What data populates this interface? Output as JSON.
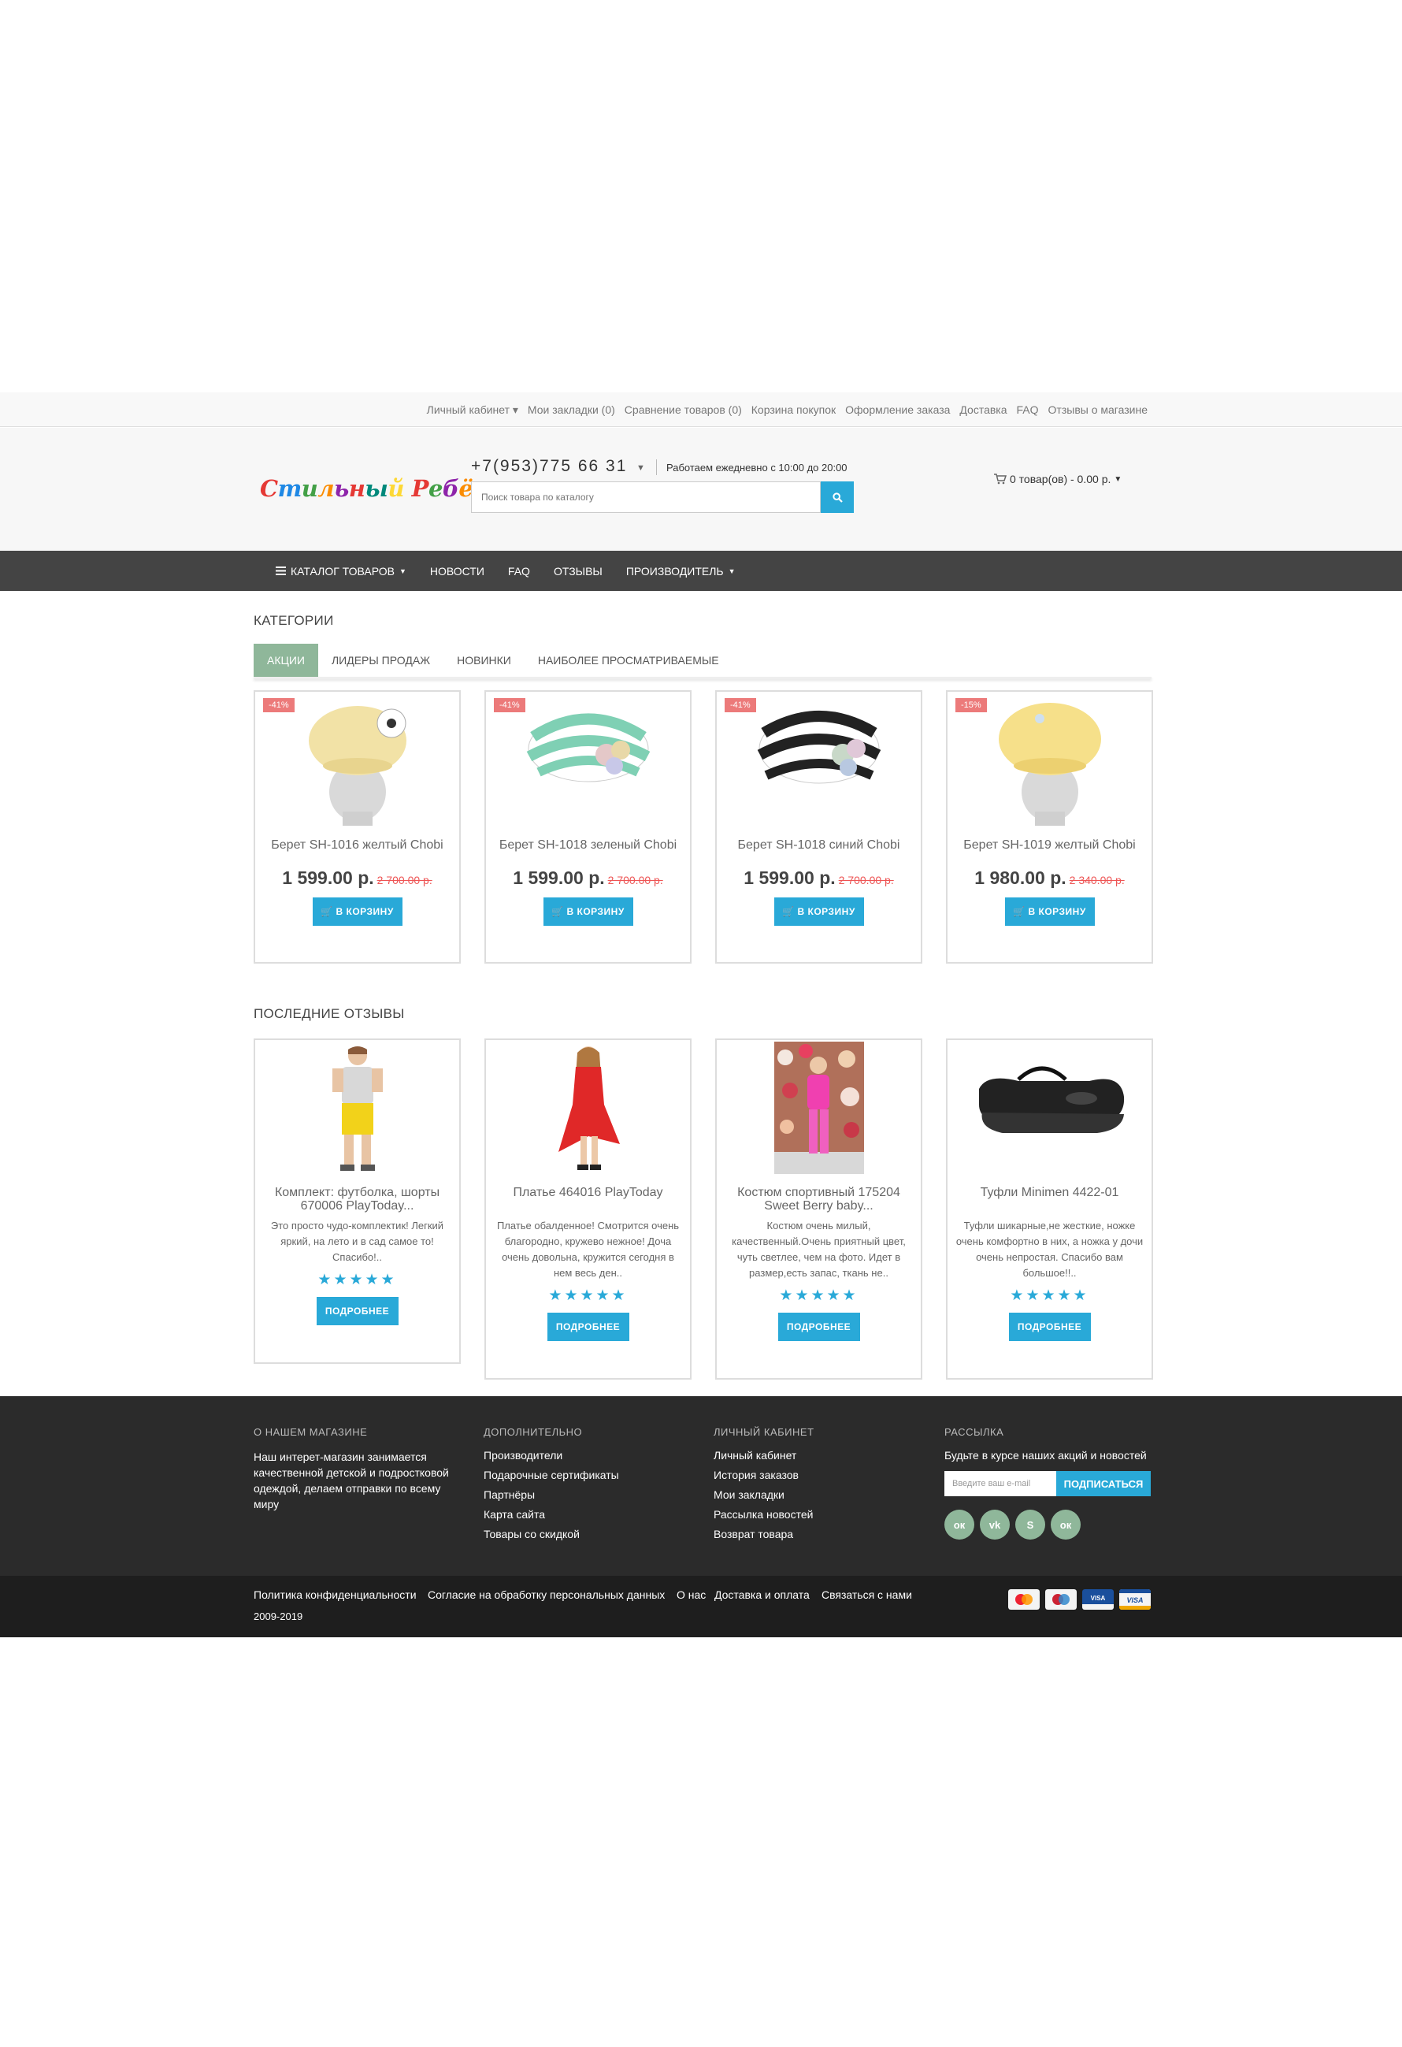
{
  "top_links": [
    {
      "label": "Личный кабинет",
      "caret": true
    },
    {
      "label": "Мои закладки (0)"
    },
    {
      "label": "Сравнение товаров (0)"
    },
    {
      "label": "Корзина покупок"
    },
    {
      "label": "Оформление заказа"
    },
    {
      "label": "Доставка"
    },
    {
      "label": "FAQ"
    },
    {
      "label": "Отзывы о магазине"
    }
  ],
  "header": {
    "logo_text": "Стильный Ребёнок",
    "phone": "+7(953)775 66 31",
    "hours": "Работаем ежедневно с 10:00 до 20:00",
    "search_placeholder": "Поиск товара по каталогу",
    "cart": "0 товар(ов) - 0.00 р."
  },
  "nav": [
    "КАТАЛОГ ТОВАРОВ",
    "НОВОСТИ",
    "FAQ",
    "ОТЗЫВЫ",
    "ПРОИЗВОДИТЕЛЬ"
  ],
  "categories": {
    "title": "КАТЕГОРИИ",
    "tabs": [
      "АКЦИИ",
      "ЛИДЕРЫ ПРОДАЖ",
      "НОВИНКИ",
      "НАИБОЛЕЕ ПРОСМАТРИВАЕМЫЕ"
    ],
    "products": [
      {
        "badge": "-41%",
        "name": "Берет SH-1016 желтый Chobi",
        "price": "1 599.00 р.",
        "old_price": "2 700.00 р.",
        "button": "В КОРЗИНУ"
      },
      {
        "badge": "-41%",
        "name": "Берет SH-1018 зеленый Chobi",
        "price": "1 599.00 р.",
        "old_price": "2 700.00 р.",
        "button": "В КОРЗИНУ"
      },
      {
        "badge": "-41%",
        "name": "Берет SH-1018 синий Chobi",
        "price": "1 599.00 р.",
        "old_price": "2 700.00 р.",
        "button": "В КОРЗИНУ"
      },
      {
        "badge": "-15%",
        "name": "Берет SH-1019 желтый Chobi",
        "price": "1 980.00 р.",
        "old_price": "2 340.00 р.",
        "button": "В КОРЗИНУ"
      }
    ]
  },
  "reviews": {
    "title": "ПОСЛЕДНИЕ ОТЗЫВЫ",
    "items": [
      {
        "name": "Комплект: футболка, шорты 670006 PlayToday...",
        "text": "Это просто чудо-комплектик! Легкий яркий, на лето и в сад самое то! Спасибо!..",
        "rating": 5,
        "button": "ПОДРОБНЕЕ"
      },
      {
        "name": "Платье 464016 PlayToday",
        "text": "Платье обалденное! Смотрится очень благородно, кружево нежное! Доча очень довольна, кружится сегодня в нем весь ден..",
        "rating": 5,
        "button": "ПОДРОБНЕЕ"
      },
      {
        "name": "Костюм спортивный 175204 Sweet Berry baby...",
        "text": "Костюм очень милый, качественный.Очень приятный цвет, чуть светлее, чем на фото. Идет в размер,есть запас, ткань не..",
        "rating": 5,
        "button": "ПОДРОБНЕЕ"
      },
      {
        "name": "Туфли Minimen 4422-01",
        "text": "Туфли шикарные,не жесткие, ножке очень комфортно в них, а ножка у дочи очень непростая. Спасибо вам большое!!..",
        "rating": 5,
        "button": "ПОДРОБНЕЕ"
      }
    ]
  },
  "footer": {
    "about": {
      "title": "О НАШЕМ МАГАЗИНЕ",
      "text": "Наш интерет-магазин занимается качественной детской и подростковой одеждой, делаем отправки по всему миру"
    },
    "extra": {
      "title": "ДОПОЛНИТЕЛЬНО",
      "links": [
        "Производители",
        "Подарочные сертификаты",
        "Партнёры",
        "Карта сайта",
        "Товары со скидкой"
      ]
    },
    "account": {
      "title": "ЛИЧНЫЙ КАБИНЕТ",
      "links": [
        "Личный кабинет",
        "История заказов",
        "Мои закладки",
        "Рассылка новостей",
        "Возврат товара"
      ]
    },
    "newsletter": {
      "title": "РАССЫЛКА",
      "text": "Будьте в курсе наших акций и новостей",
      "placeholder": "Введите ваш e-mail",
      "button": "ПОДПИСАТЬСЯ"
    },
    "social": [
      "odnoklassniki-icon",
      "vk-icon",
      "skype-icon",
      "odnoklassniki-icon"
    ],
    "bottom_links": [
      "Политика конфиденциальности",
      "Согласие на обработку персональных данных",
      "О нас",
      "Доставка и оплата",
      "Связаться с нами"
    ],
    "copyright": "2009-2019",
    "payments": [
      "mastercard-icon",
      "maestro-icon",
      "visa-electron-icon",
      "visa-icon"
    ]
  },
  "colors": {
    "accent": "#29a9d8",
    "tab_active": "#8fb79a",
    "nav_bg": "#444444",
    "footer_bg": "#2b2b2b",
    "badge": "#ec7a7a"
  }
}
